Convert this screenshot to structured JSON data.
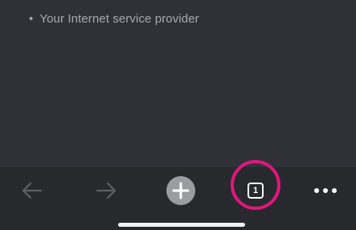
{
  "page": {
    "bullet_char": "•",
    "bullet_text": "Your Internet service provider"
  },
  "toolbar": {
    "back_icon": "back-arrow-icon",
    "forward_icon": "forward-arrow-icon",
    "new_tab_icon": "plus-circle-icon",
    "tab_count": "1",
    "more_icon": "ellipsis-icon"
  },
  "colors": {
    "background": "#303136",
    "toolbar": "#28292d",
    "highlight": "#e0167e",
    "muted_text": "#a9a9ad",
    "icon_active": "#ffffff",
    "icon_disabled": "#5e5f64"
  }
}
